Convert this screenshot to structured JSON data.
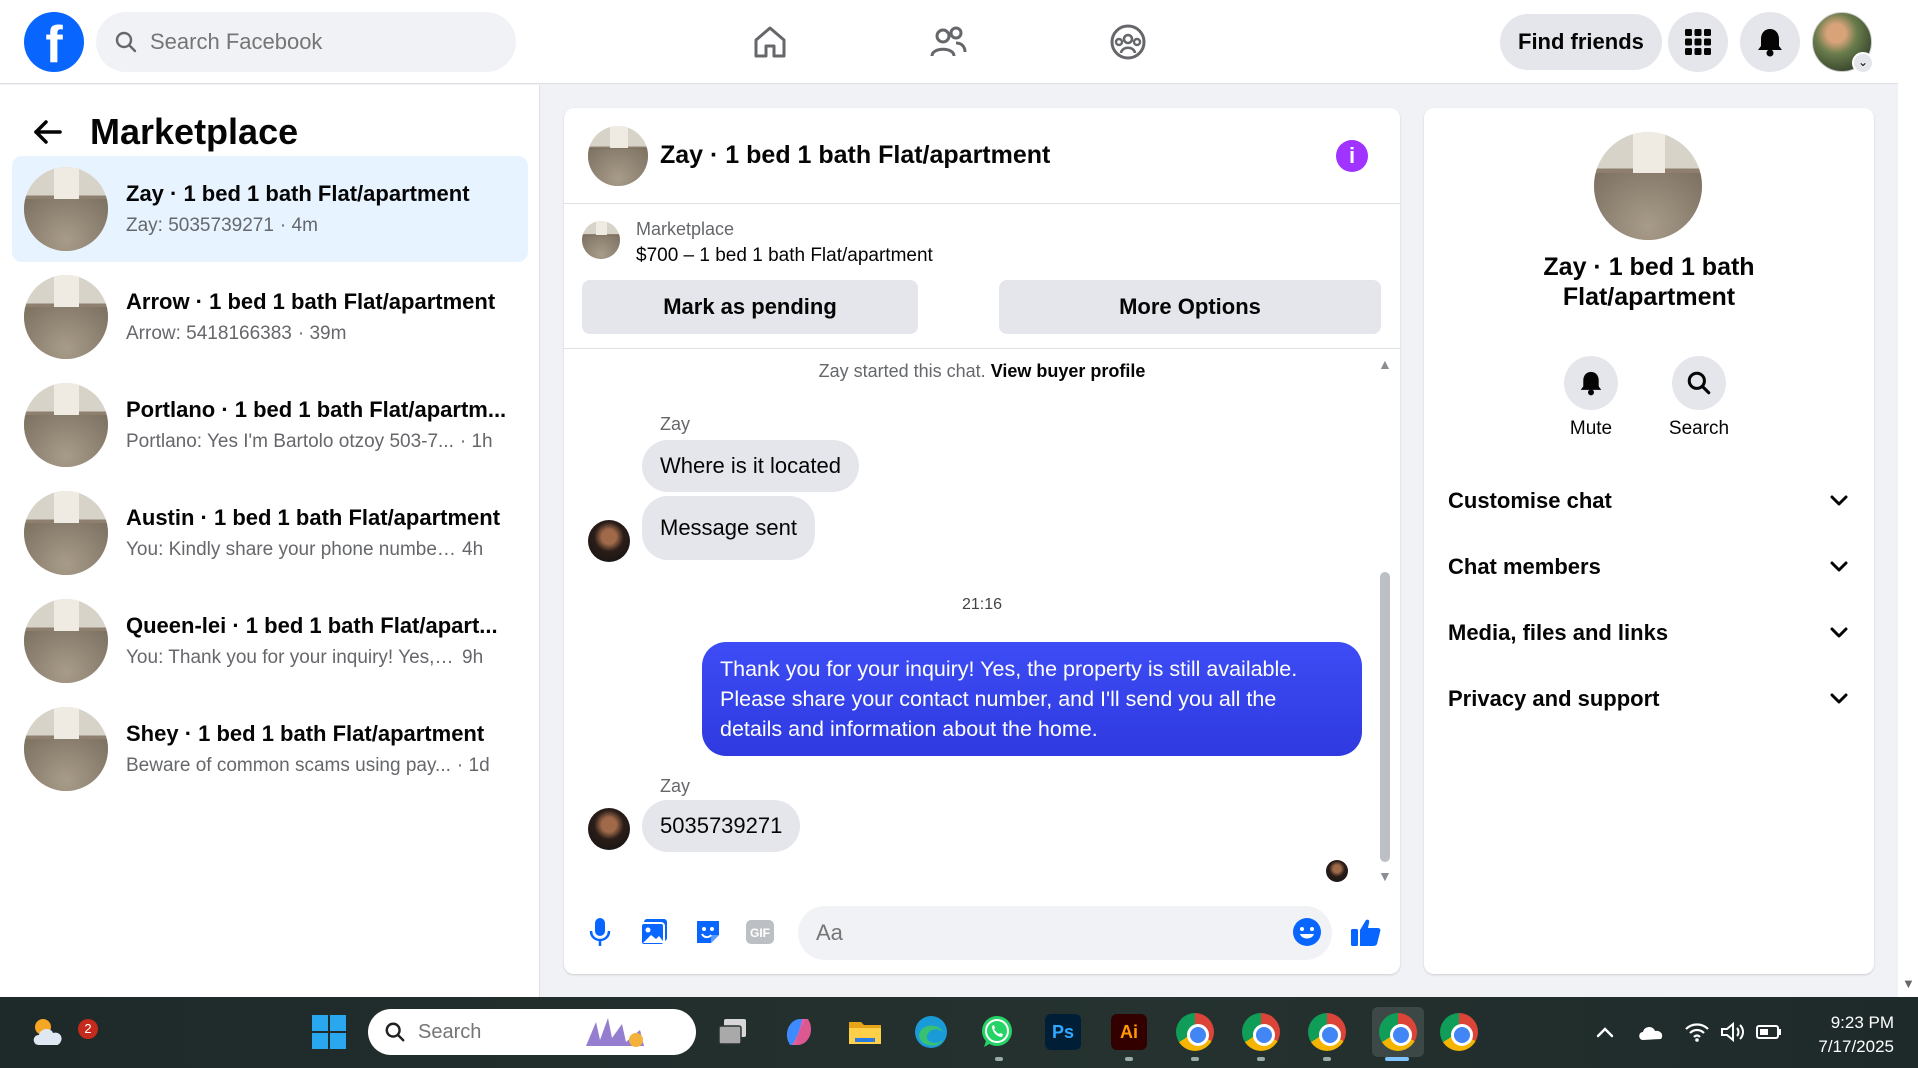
{
  "topbar": {
    "logo_letter": "f",
    "search_placeholder": "Search Facebook",
    "find_friends": "Find friends"
  },
  "sidebar": {
    "title": "Marketplace",
    "conversations": [
      {
        "name": "Zay · 1 bed 1 bath Flat/apartment",
        "snippet": "Zay: 5035739271",
        "time": "· 4m",
        "active": true
      },
      {
        "name": "Arrow · 1 bed 1 bath Flat/apartment",
        "snippet": "Arrow: 5418166383",
        "time": "· 39m"
      },
      {
        "name": "Portlano · 1 bed 1 bath Flat/apartm...",
        "snippet": "Portlano: Yes I'm Bartolo otzoy 503-7...",
        "time": "· 1h"
      },
      {
        "name": "Austin · 1 bed 1 bath Flat/apartment",
        "snippet": "You: Kindly share your phone number,...",
        "time": "4h"
      },
      {
        "name": "Queen-lei · 1 bed 1 bath Flat/apart...",
        "snippet": "You: Thank you for your inquiry! Yes, t...",
        "time": "9h"
      },
      {
        "name": "Shey · 1 bed 1 bath Flat/apartment",
        "snippet": "Beware of common scams using pay...",
        "time": "· 1d"
      }
    ]
  },
  "chat": {
    "title": "Zay · 1 bed 1 bath Flat/apartment",
    "listing_label": "Marketplace",
    "listing_price": "$700 – 1 bed 1 bath Flat/apartment",
    "mark_pending": "Mark as pending",
    "more_options": "More Options",
    "started_text": "Zay started this chat.",
    "view_profile": "View buyer profile",
    "sender1": "Zay",
    "msg1": "Where is it located",
    "msg2": "Message sent",
    "timestamp": "21:16",
    "msg3": "Thank you for your inquiry! Yes, the property is still available. Please share your contact number, and I'll send you all the details and information about the home.",
    "sender2": "Zay",
    "msg4": "5035739271",
    "composer_placeholder": "Aa"
  },
  "info": {
    "title": "Zay · 1 bed 1 bath Flat/apartment",
    "mute": "Mute",
    "search": "Search",
    "sections": [
      "Customise chat",
      "Chat members",
      "Media, files and links",
      "Privacy and support"
    ]
  },
  "taskbar": {
    "weather_badge": "2",
    "search_placeholder": "Search",
    "ps_label": "Ps",
    "ai_label": "Ai",
    "gif_label": "GIF",
    "time": "9:23 PM",
    "date": "7/17/2025"
  },
  "colors": {
    "brand": "#0866ff",
    "outgoing_bubble": "#3b3bf0",
    "active_conversation": "#e7f3ff",
    "info_icon": "#a033ff"
  }
}
